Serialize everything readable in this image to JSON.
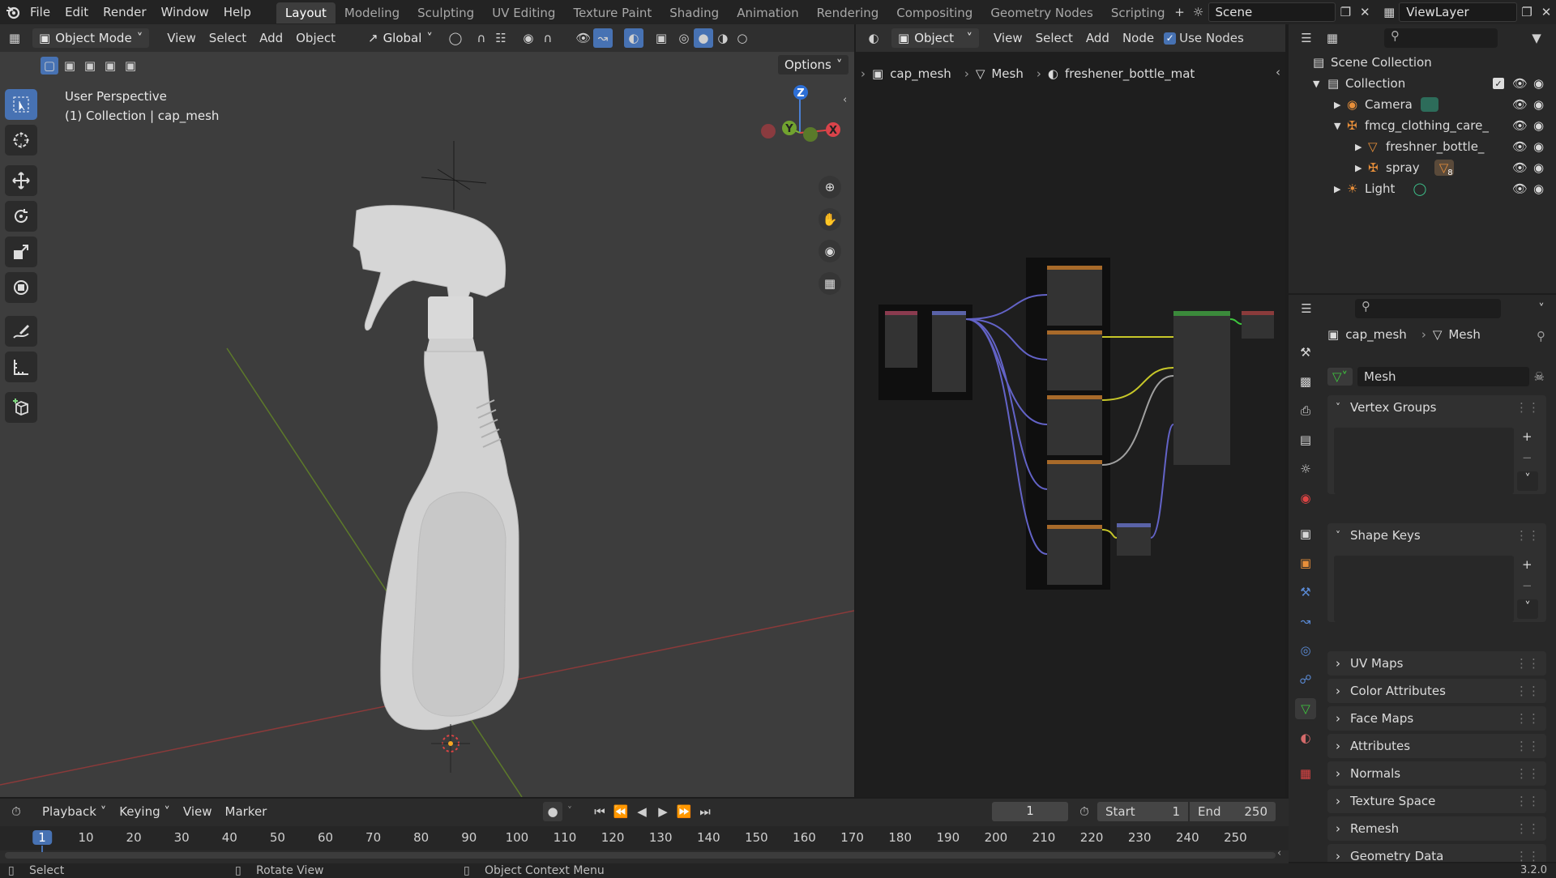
{
  "menu": {
    "file": "File",
    "edit": "Edit",
    "render": "Render",
    "window": "Window",
    "help": "Help"
  },
  "workspaces": [
    "Layout",
    "Modeling",
    "Sculpting",
    "UV Editing",
    "Texture Paint",
    "Shading",
    "Animation",
    "Rendering",
    "Compositing",
    "Geometry Nodes",
    "Scripting"
  ],
  "scene": {
    "name": "Scene",
    "view_layer": "ViewLayer"
  },
  "viewport": {
    "mode": "Object Mode",
    "view": "View",
    "select": "Select",
    "add": "Add",
    "object": "Object",
    "orientation": "Global",
    "options": "Options",
    "perspective": "User Perspective",
    "context": "(1) Collection | cap_mesh",
    "gizmo": {
      "z": "Z",
      "y": "Y",
      "x": "X"
    }
  },
  "node_editor": {
    "type": "Object",
    "view": "View",
    "select": "Select",
    "add": "Add",
    "node": "Node",
    "use_nodes": "Use Nodes",
    "breadcrumb": [
      "cap_mesh",
      "Mesh",
      "freshener_bottle_mat"
    ]
  },
  "outliner": {
    "scene_collection": "Scene Collection",
    "rows": [
      {
        "label": "Collection"
      },
      {
        "label": "Camera"
      },
      {
        "label": "fmcg_clothing_care_"
      },
      {
        "label": "freshner_bottle_"
      },
      {
        "label": "spray",
        "badge": "8"
      },
      {
        "label": "Light"
      }
    ]
  },
  "properties": {
    "breadcrumb": [
      "cap_mesh",
      "Mesh"
    ],
    "datablock": "Mesh",
    "panels": [
      "Vertex Groups",
      "Shape Keys",
      "UV Maps",
      "Color Attributes",
      "Face Maps",
      "Attributes",
      "Normals",
      "Texture Space",
      "Remesh",
      "Geometry Data"
    ]
  },
  "timeline": {
    "playback": "Playback",
    "keying": "Keying",
    "view": "View",
    "marker": "Marker",
    "current_frame": "1",
    "start_label": "Start",
    "start": "1",
    "end_label": "End",
    "end": "250",
    "ticks": [
      "1",
      "10",
      "20",
      "30",
      "40",
      "50",
      "60",
      "70",
      "80",
      "90",
      "100",
      "110",
      "120",
      "130",
      "140",
      "150",
      "160",
      "170",
      "180",
      "190",
      "200",
      "210",
      "220",
      "230",
      "240",
      "250"
    ]
  },
  "status": {
    "select": "Select",
    "rotate": "Rotate View",
    "context": "Object Context Menu",
    "version": "3.2.0"
  }
}
